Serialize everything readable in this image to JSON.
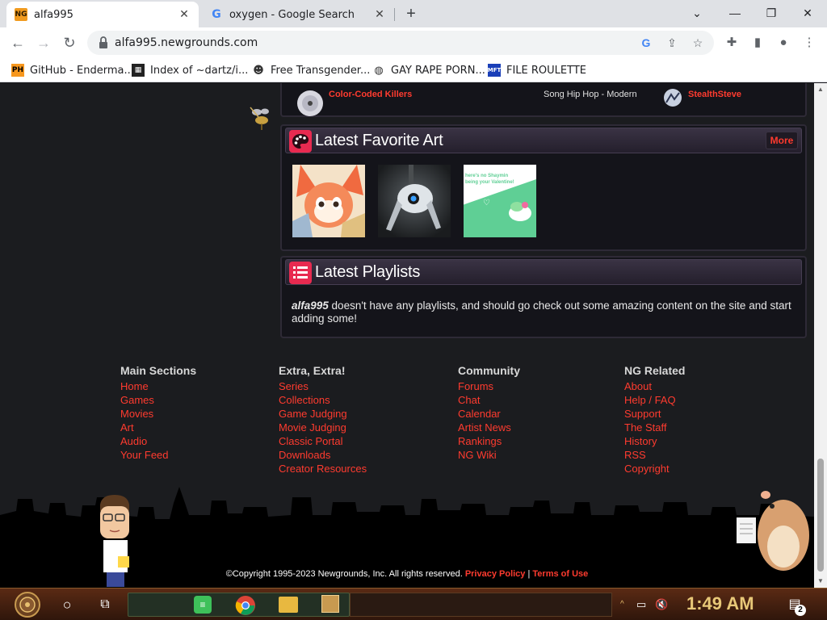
{
  "browser": {
    "tabs": [
      {
        "title": "alfa995",
        "favicon": "newgrounds-icon",
        "active": true
      },
      {
        "title": "oxygen - Google Search",
        "favicon": "google-icon",
        "active": false
      }
    ],
    "url": "alfa995.newgrounds.com",
    "bookmarks": [
      {
        "label": "GitHub - Enderma...",
        "icon": "ph-icon"
      },
      {
        "label": "Index of ~dartz/i...",
        "icon": "index-icon"
      },
      {
        "label": "Free Transgender...",
        "icon": "mask-icon"
      },
      {
        "label": "GAY RAPE PORN...",
        "icon": "globe-icon"
      },
      {
        "label": "FILE ROULETTE",
        "icon": "file-roulette-icon"
      }
    ]
  },
  "top_strip": {
    "item_title": "Color-Coded Killers",
    "genre": "Song Hip Hop - Modern",
    "author": "StealthSteve"
  },
  "favorite_art": {
    "title": "Latest Favorite Art",
    "more_label": "More",
    "thumb3_caption": "here's no Shaymin\nbeing your Valentine!"
  },
  "playlists": {
    "title": "Latest Playlists",
    "user": "alfa995",
    "message": " doesn't have any playlists, and should go check out some amazing content on the site and start adding some!"
  },
  "footer": {
    "columns": [
      {
        "heading": "Main Sections",
        "links": [
          "Home",
          "Games",
          "Movies",
          "Art",
          "Audio",
          "Your Feed"
        ]
      },
      {
        "heading": "Extra, Extra!",
        "links": [
          "Series",
          "Collections",
          "Game Judging",
          "Movie Judging",
          "Classic Portal",
          "Downloads",
          "Creator Resources"
        ]
      },
      {
        "heading": "Community",
        "links": [
          "Forums",
          "Chat",
          "Calendar",
          "Artist News",
          "Rankings",
          "NG Wiki"
        ]
      },
      {
        "heading": "NG Related",
        "links": [
          "About",
          "Help / FAQ",
          "Support",
          "The Staff",
          "History",
          "RSS",
          "Copyright"
        ]
      }
    ],
    "copyright": "©Copyright 1995-2023 Newgrounds, Inc. All rights reserved. ",
    "privacy": "Privacy Policy",
    "separator": " | ",
    "terms": "Terms of Use"
  },
  "taskbar": {
    "clock": "1:49 AM",
    "notification_count": "2"
  },
  "colors": {
    "ng_red": "#ff3b2f",
    "page_bg": "#1b1c1f",
    "panel_head": "#3a3344",
    "clock": "#e8c878"
  }
}
